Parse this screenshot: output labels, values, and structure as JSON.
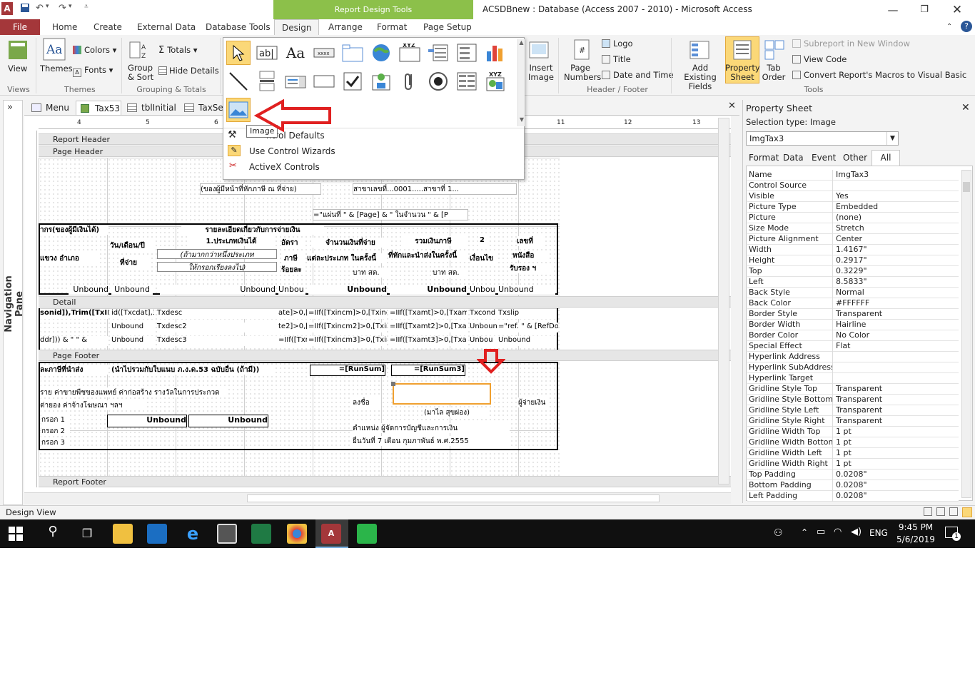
{
  "window": {
    "title": "ACSDBnew : Database (Access 2007 - 2010)  -  Microsoft Access",
    "context_tab_group": "Report Design Tools",
    "app_icon": "A"
  },
  "ribbon_tabs": [
    "File",
    "Home",
    "Create",
    "External Data",
    "Database Tools",
    "Design",
    "Arrange",
    "Format",
    "Page Setup"
  ],
  "ribbon": {
    "views": {
      "view_label": "View",
      "group": "Views"
    },
    "themes": {
      "themes_label": "Themes",
      "colors_label": "Colors",
      "fonts_label": "Fonts",
      "group": "Themes"
    },
    "grouping": {
      "group_sort_label": "Group & Sort",
      "totals_label": "Totals",
      "hide_details_label": "Hide Details",
      "group": "Grouping & Totals"
    },
    "insert_image_label": "Insert Image",
    "header_footer": {
      "page_numbers_label": "Page Numbers",
      "logo_label": "Logo",
      "title_label": "Title",
      "date_time_label": "Date and Time",
      "group": "Header / Footer"
    },
    "tools": {
      "add_fields_label": "Add Existing Fields",
      "property_sheet_label": "Property Sheet",
      "tab_order_label": "Tab Order",
      "subreport_label": "Subreport in New Window",
      "view_code_label": "View Code",
      "convert_macros_label": "Convert Report's Macros to Visual Basic",
      "group": "Tools"
    }
  },
  "controls_gallery": {
    "tooltip": "Image",
    "menu": [
      "Set Control Defaults",
      "Use Control Wizards",
      "ActiveX Controls"
    ],
    "menu_visible_first": "ntrol Defaults"
  },
  "doc_tabs": [
    "Menu",
    "Tax53",
    "tblInitial",
    "TaxSen"
  ],
  "nav_pane_label": "Navigation Pane",
  "report": {
    "sections": [
      "Report Header",
      "Page Header",
      "Detail",
      "Page Footer",
      "Report Footer"
    ],
    "page_header": {
      "payer_line": "(ของผู้มีหน้าที่หักภาษี ณ ที่จ่าย)",
      "branch_line": "สาขาเลขที่...0001.....สาขาที่ 1...",
      "sheet_expr": "=\"แผ่นที่ \" & [Page] & \"  ในจำนวน \" & [P",
      "col_recipient": "ากร(ของผู้มีเงินได้)",
      "col_payment_detail": "รายละเอียดเกี่ยวกับการจ่ายเงิน",
      "col_date": "วัน/เดือน/ปี",
      "col_date2": "ที่จ่าย",
      "col_income_type": "1.ประเภทเงินได้",
      "col_income_type2": "(ถ้ามากกว่าหนึ่งประเภท",
      "col_income_type3": "ให้กรอกเรียงลงไป)",
      "col_rate": "อัตรา",
      "col_rate2": "ภาษี",
      "col_rate3": "ร้อยละ",
      "col_amount": "จำนวนเงินที่จ่าย",
      "col_amount2": "แต่ละประเภท  ในครั้งนี้",
      "col_amount3": "บาท    สต.",
      "col_tax": "รวมเงินภาษี",
      "col_tax2": "ที่หักและนำส่งในครั้งนี้",
      "col_tax3": "บาท    สต.",
      "col_cond": "2",
      "col_cond2": "เงื่อนไข",
      "col_doc": "เลขที่",
      "col_doc2": "หนังสือ",
      "col_doc3": "รับรอง ฯ",
      "col_district": "แขวง อำเภอ",
      "unbound": [
        "Unbound",
        "Unbound",
        "Unbound",
        "Unbou",
        "Unbound",
        "Unbound",
        "Unbou",
        "Unbound"
      ]
    },
    "detail": {
      "row1": [
        "sonid]),Trim([TxID]))",
        "id([Txcdat],3,",
        "Txdesc",
        "ate]>0,[",
        "=IIf([Txincm]>0,[Txincm]",
        "=IIf([Txamt]>0,[Txamt])",
        "Txcond",
        "Txslip"
      ],
      "row2": [
        "Unbound",
        "Txdesc2",
        "te2]>0,[",
        "=IIf([Txincm2]>0,[Txincm",
        "=IIf([Txamt2]>0,[Txamt2",
        "Unbound",
        "=\"ref. \" & [RefDoc"
      ],
      "row3": [
        "ddr])) & \" \" &",
        "Unbound",
        "Txdesc3",
        "=IIf([Txr",
        "=IIf([Txincm3]>0,[Txinc",
        "=IIf([Txamt3]>0,[Txamt3",
        "Unbou",
        "Unbound"
      ]
    },
    "page_footer": {
      "tax_submit": "ละภาษีที่นำส่ง",
      "carry_note": "(นำไปรวมกับใบแนบ ภ.ง.ด.53 ฉบับอื่น (ถ้ามี))",
      "runsum": "=[RunSum]",
      "runsum3": "=[RunSum3]",
      "note1": "ราย ค่าขายพืชของแพทย์ ค่าก่อสร้าง รางวัลในการประกวด",
      "note2": "ต่ายอง ค่าจ้างโฆษณา ฯลฯ",
      "fill1": "กรอก 1",
      "fill2": "กรอก 2",
      "fill3": "กรอก 3",
      "unbound1": "Unbound",
      "unbound2": "Unbound",
      "sign_label": "ลงชื่อ",
      "payer_label": "ผู้จ่ายเงิน",
      "signer_name": "(มาไล  สุขผ่อง)",
      "position": "ตำแหน่ง   ผู้จัดการบัญชีและการเงิน",
      "submit_date": "ยื่นวันที่ 7 เดือน กุมภาพันธ์ พ.ศ.2555"
    }
  },
  "ruler_numbers": [
    "4",
    "5",
    "6",
    "11",
    "12",
    "13"
  ],
  "property_sheet": {
    "title": "Property Sheet",
    "selection_type_label": "Selection type:  Image",
    "selected_object": "ImgTax3",
    "tabs": [
      "Format",
      "Data",
      "Event",
      "Other",
      "All"
    ],
    "active_tab": "All",
    "rows": [
      [
        "Name",
        "ImgTax3"
      ],
      [
        "Control Source",
        ""
      ],
      [
        "Visible",
        "Yes"
      ],
      [
        "Picture Type",
        "Embedded"
      ],
      [
        "Picture",
        "(none)"
      ],
      [
        "Size Mode",
        "Stretch"
      ],
      [
        "Picture Alignment",
        "Center"
      ],
      [
        "Width",
        "1.4167\""
      ],
      [
        "Height",
        "0.2917\""
      ],
      [
        "Top",
        "0.3229\""
      ],
      [
        "Left",
        "8.5833\""
      ],
      [
        "Back Style",
        "Normal"
      ],
      [
        "Back Color",
        "#FFFFFF"
      ],
      [
        "Border Style",
        "Transparent"
      ],
      [
        "Border Width",
        "Hairline"
      ],
      [
        "Border Color",
        "No Color"
      ],
      [
        "Special Effect",
        "Flat"
      ],
      [
        "Hyperlink Address",
        ""
      ],
      [
        "Hyperlink SubAddress",
        ""
      ],
      [
        "Hyperlink Target",
        ""
      ],
      [
        "Gridline Style Top",
        "Transparent"
      ],
      [
        "Gridline Style Bottom",
        "Transparent"
      ],
      [
        "Gridline Style Left",
        "Transparent"
      ],
      [
        "Gridline Style Right",
        "Transparent"
      ],
      [
        "Gridline Width Top",
        "1 pt"
      ],
      [
        "Gridline Width Bottom",
        "1 pt"
      ],
      [
        "Gridline Width Left",
        "1 pt"
      ],
      [
        "Gridline Width Right",
        "1 pt"
      ],
      [
        "Top Padding",
        "0.0208\""
      ],
      [
        "Bottom Padding",
        "0.0208\""
      ],
      [
        "Left Padding",
        "0.0208\""
      ]
    ]
  },
  "status_bar": {
    "text": "Design View"
  },
  "taskbar": {
    "time": "9:45 PM",
    "date": "5/6/2019",
    "language": "ENG",
    "notification_count": "1"
  },
  "colors": {
    "file_tab": "#a4373a",
    "context_green": "#8cc04a",
    "selection_orange": "#f0a030",
    "arrow_red": "#e02020"
  }
}
